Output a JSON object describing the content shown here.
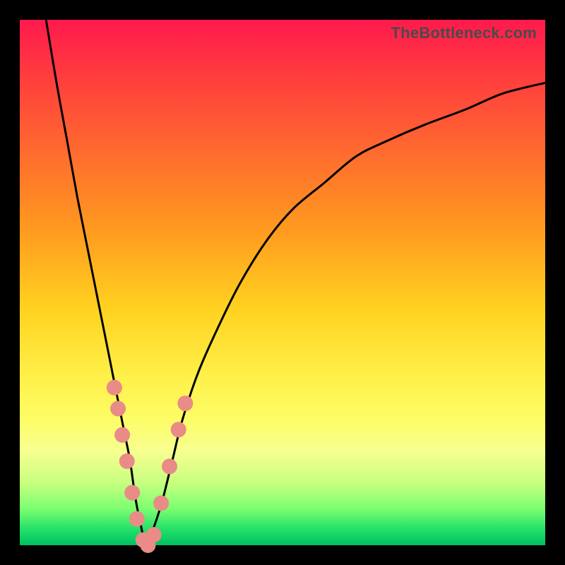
{
  "watermark": "TheBottleneck.com",
  "colors": {
    "frame": "#000000",
    "curve": "#000000",
    "marker_fill": "#e98b86",
    "marker_stroke": "#e98b86"
  },
  "chart_data": {
    "type": "line",
    "title": "",
    "xlabel": "",
    "ylabel": "",
    "xlim": [
      0,
      100
    ],
    "ylim": [
      0,
      100
    ],
    "grid": false,
    "legend": false,
    "series": [
      {
        "name": "bottleneck-curve",
        "x": [
          5,
          7,
          9,
          11,
          13,
          15,
          17,
          19,
          20,
          21,
          22,
          23,
          24,
          25,
          27,
          29,
          31,
          34,
          38,
          42,
          47,
          52,
          58,
          64,
          70,
          77,
          85,
          92,
          100
        ],
        "y": [
          100,
          88,
          77,
          66,
          56,
          46,
          36,
          26,
          21,
          16,
          9,
          4,
          0,
          2,
          8,
          16,
          24,
          33,
          42,
          50,
          58,
          64,
          69,
          74,
          77,
          80,
          83,
          86,
          88
        ]
      }
    ],
    "markers": [
      {
        "x": 18.0,
        "y": 30
      },
      {
        "x": 18.7,
        "y": 26
      },
      {
        "x": 19.5,
        "y": 21
      },
      {
        "x": 20.4,
        "y": 16
      },
      {
        "x": 21.4,
        "y": 10
      },
      {
        "x": 22.3,
        "y": 5
      },
      {
        "x": 23.5,
        "y": 1
      },
      {
        "x": 24.4,
        "y": 0
      },
      {
        "x": 25.5,
        "y": 2
      },
      {
        "x": 26.9,
        "y": 8
      },
      {
        "x": 28.5,
        "y": 15
      },
      {
        "x": 30.2,
        "y": 22
      },
      {
        "x": 31.5,
        "y": 27
      }
    ]
  }
}
